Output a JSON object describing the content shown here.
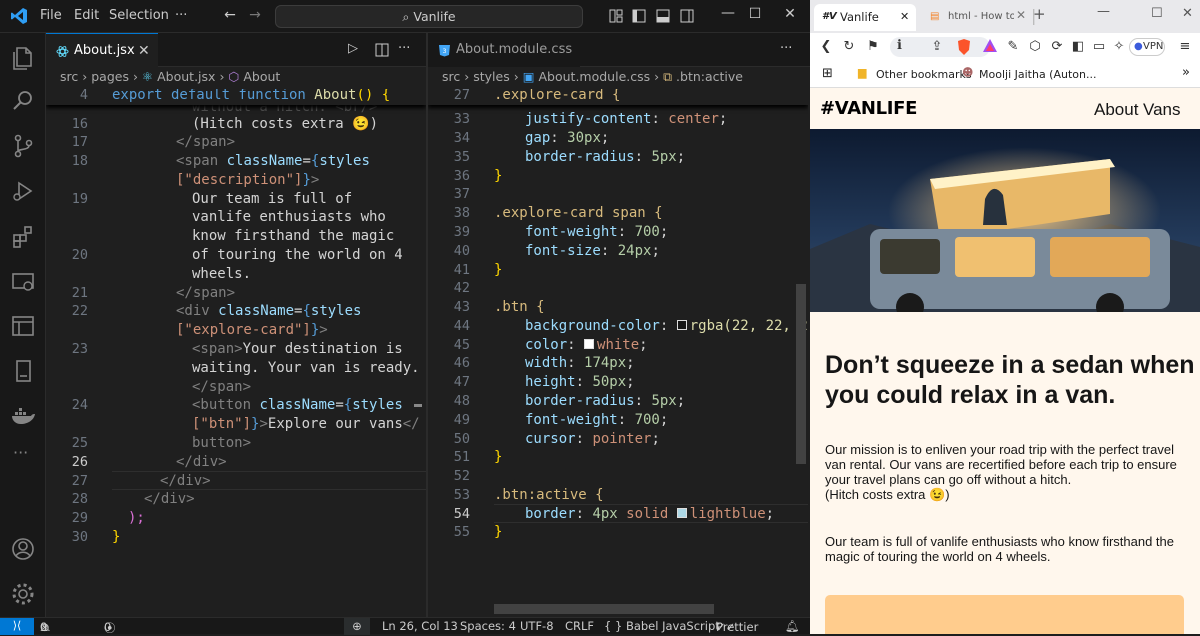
{
  "vscode": {
    "menu": [
      "File",
      "Edit",
      "Selection",
      "···"
    ],
    "search": "Vanlife",
    "statusbar": {
      "errors": "0",
      "warnings": "0",
      "ports": "0",
      "position": "Ln 26, Col 13",
      "spaces": "Spaces: 4",
      "encoding": "UTF-8",
      "eol": "CRLF",
      "language": "{ } Babel JavaScript",
      "formatter": "Prettier"
    },
    "left_editor": {
      "tab": "About.jsx",
      "breadcrumb": [
        "src",
        "pages",
        "About.jsx",
        "About"
      ],
      "sticky_line": "4",
      "sticky_code": "export default function About() {",
      "overlap_text": "without a hitch. <br/>",
      "line_numbers": [
        "16",
        "17",
        "18",
        "",
        "19",
        "",
        "",
        "20",
        "",
        "21",
        "22",
        "",
        "23",
        "",
        "",
        "24",
        "",
        "25",
        "26",
        "27",
        "28",
        "29",
        "30"
      ],
      "current_line": "26",
      "lines": {
        "l16": "(Hitch costs extra 😉)",
        "l17": "</span>",
        "l18a": "<span",
        "l18b": "className",
        "l18c": "styles",
        "l18d": "[\"description\"]",
        "l19a": "Our team is full of",
        "l19b": "vanlife enthusiasts who",
        "l19c": "know firsthand the magic",
        "l20a": "of touring the world on 4",
        "l20b": "wheels.",
        "l21": "</span>",
        "l22a": "<div",
        "l22b": "className",
        "l22c": "styles",
        "l22d": "[\"explore-card\"]",
        "l23a": "<span>",
        "l23b": "Your destination is",
        "l23c": "waiting. Your van is ready.",
        "l23d": "</span>",
        "l24a": "<button",
        "l24b": "className",
        "l24c": "styles",
        "l24d": "[\"btn\"]",
        "l24e": "Explore our vans",
        "l24f": "</",
        "l24g": "button>",
        "l25": "</div>",
        "l26": "</div>",
        "l27": "</div>",
        "l28": ");",
        "l29": "}"
      }
    },
    "right_editor": {
      "tab": "About.module.css",
      "breadcrumb": [
        "src",
        "styles",
        "About.module.css",
        ".btn:active"
      ],
      "sticky_line": "27",
      "sticky_code": ".explore-card {",
      "line_numbers": [
        "33",
        "34",
        "35",
        "36",
        "37",
        "38",
        "39",
        "40",
        "41",
        "42",
        "43",
        "44",
        "45",
        "46",
        "47",
        "48",
        "49",
        "50",
        "51",
        "52",
        "53",
        "54",
        "55"
      ],
      "current_line": "54",
      "lines": {
        "l33p": "justify-content",
        "l33v": "center",
        "l34p": "gap",
        "l34v": "30px",
        "l35p": "border-radius",
        "l35v": "5px",
        "l36": "}",
        "l38s": ".explore-card span {",
        "l39p": "font-weight",
        "l39v": "700",
        "l40p": "font-size",
        "l40v": "24px",
        "l41": "}",
        "l43s": ".btn {",
        "l44p": "background-color",
        "l44v": "rgba(22, 22, 22,",
        "l45p": "color",
        "l45v": "white",
        "l46p": "width",
        "l46v": "174px",
        "l47p": "height",
        "l47v": "50px",
        "l48p": "border-radius",
        "l48v": "5px",
        "l49p": "font-weight",
        "l49v": "700",
        "l50p": "cursor",
        "l50v": "pointer",
        "l51": "}",
        "l53s": ".btn:active {",
        "l54p": "border",
        "l54a": "4px",
        "l54b": "solid",
        "l54v": "lightblue",
        "l55": "}"
      }
    }
  },
  "browser": {
    "tabs": [
      {
        "label": "Vanlife",
        "active": true
      },
      {
        "label": "html - How to s",
        "active": false
      }
    ],
    "vpn": "VPN",
    "bookmarks": [
      "Other bookmarks",
      "Moolji Jaitha (Auton..."
    ],
    "page": {
      "logo": "#VANLIFE",
      "nav": [
        "About",
        "Vans"
      ],
      "headline": "Don’t squeeze in a sedan when you could relax in a van.",
      "para1": "Our mission is to enliven your road trip with the perfect travel van rental. Our vans are recertified before each trip to ensure your travel plans can go off without a hitch.",
      "para1b": "(Hitch costs extra 😉)",
      "para2": "Our team is full of vanlife enthusiasts who know firsthand the magic of touring the world on 4 wheels."
    }
  },
  "colors": {
    "accent": "#0078d4",
    "page_bg": "#fff7ed",
    "card": "#ffcc8d",
    "brave": "#fb542b"
  }
}
